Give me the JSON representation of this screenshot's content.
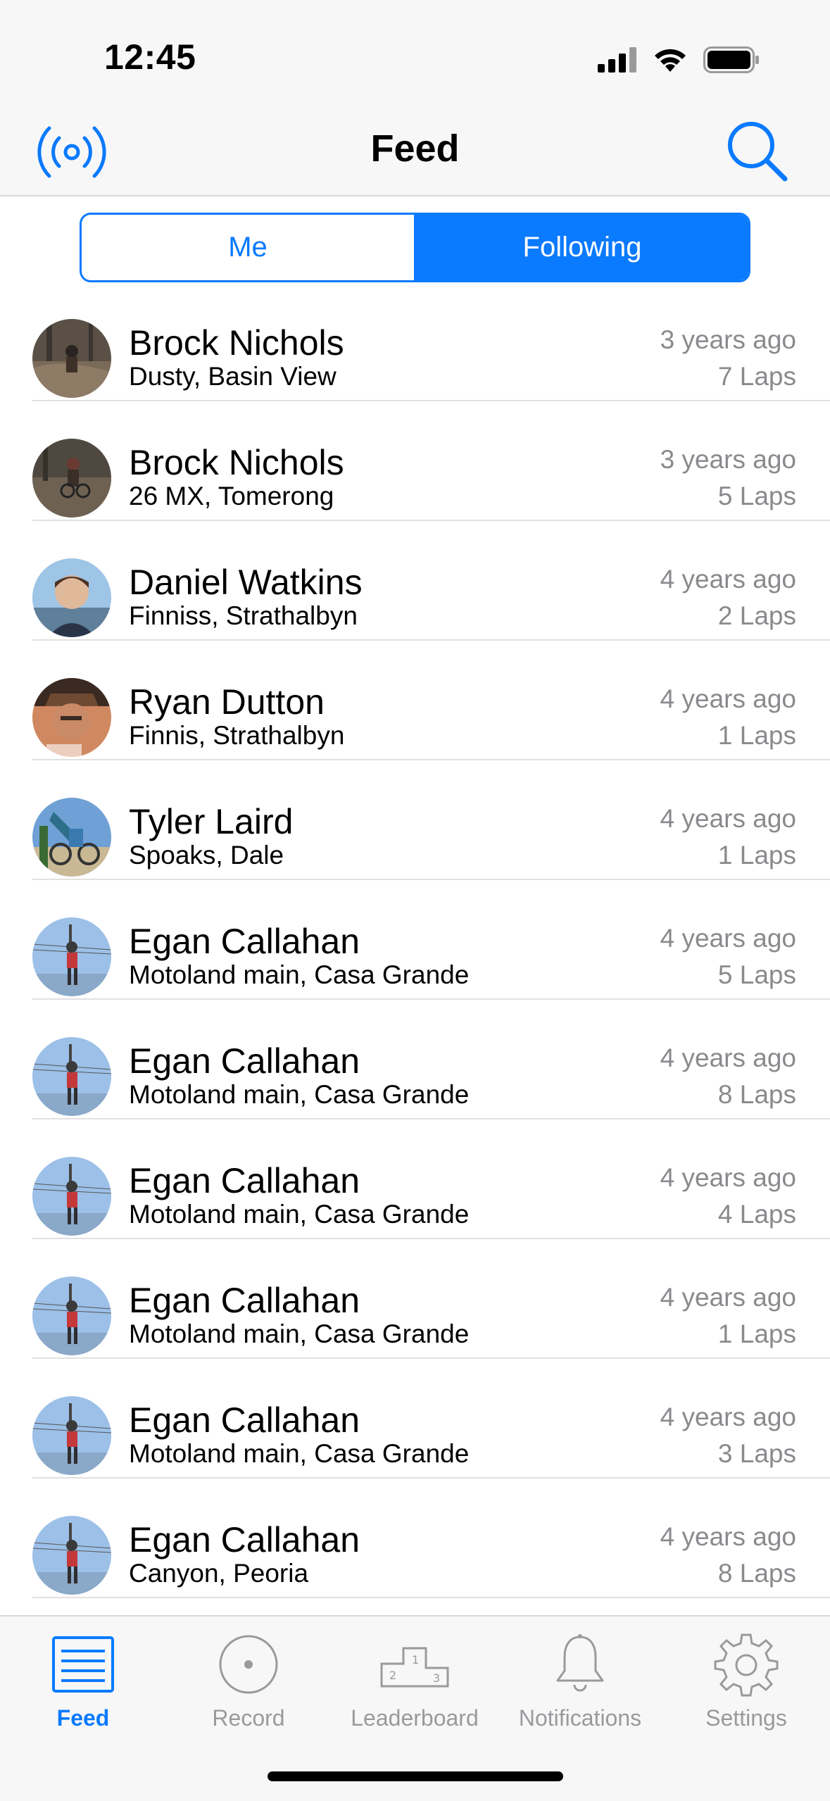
{
  "status_bar": {
    "time": "12:45"
  },
  "nav": {
    "title": "Feed",
    "left_icon": "broadcast-icon",
    "right_icon": "search-icon"
  },
  "segments": {
    "me": "Me",
    "following": "Following",
    "selected": "Following"
  },
  "feed": [
    {
      "name": "Brock Nichols",
      "location": "Dusty, Basin View",
      "ago": "3 years ago",
      "laps": "7 Laps"
    },
    {
      "name": "Brock Nichols",
      "location": "26 MX, Tomerong",
      "ago": "3 years ago",
      "laps": "5 Laps"
    },
    {
      "name": "Daniel Watkins",
      "location": "Finniss, Strathalbyn",
      "ago": "4 years ago",
      "laps": "2 Laps"
    },
    {
      "name": "Ryan Dutton",
      "location": "Finnis, Strathalbyn",
      "ago": "4 years ago",
      "laps": "1 Laps"
    },
    {
      "name": "Tyler Laird",
      "location": "Spoaks, Dale",
      "ago": "4 years ago",
      "laps": "1 Laps"
    },
    {
      "name": "Egan Callahan",
      "location": "Motoland main, Casa Grande",
      "ago": "4 years ago",
      "laps": "5 Laps"
    },
    {
      "name": "Egan Callahan",
      "location": "Motoland main, Casa Grande",
      "ago": "4 years ago",
      "laps": "8 Laps"
    },
    {
      "name": "Egan Callahan",
      "location": "Motoland main, Casa Grande",
      "ago": "4 years ago",
      "laps": "4 Laps"
    },
    {
      "name": "Egan Callahan",
      "location": "Motoland main, Casa Grande",
      "ago": "4 years ago",
      "laps": "1 Laps"
    },
    {
      "name": "Egan Callahan",
      "location": "Motoland main, Casa Grande",
      "ago": "4 years ago",
      "laps": "3 Laps"
    },
    {
      "name": "Egan Callahan",
      "location": "Canyon, Peoria",
      "ago": "4 years ago",
      "laps": "8 Laps"
    }
  ],
  "tabs": [
    {
      "label": "Feed",
      "icon": "list-icon",
      "active": true
    },
    {
      "label": "Record",
      "icon": "record-icon",
      "active": false
    },
    {
      "label": "Leaderboard",
      "icon": "podium-icon",
      "active": false
    },
    {
      "label": "Notifications",
      "icon": "bell-icon",
      "active": false
    },
    {
      "label": "Settings",
      "icon": "gear-icon",
      "active": false
    }
  ],
  "colors": {
    "accent": "#0a7aff",
    "secondary_text": "#8a8a8e",
    "bar_bg": "#f7f7f7"
  }
}
